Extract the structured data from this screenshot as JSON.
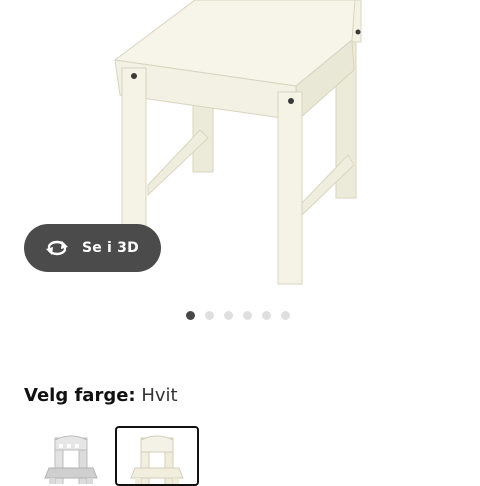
{
  "product": {
    "image_alt": "Barnestol, hvit"
  },
  "view_3d": {
    "label": "Se i 3D",
    "icon": "rotate-3d-icon"
  },
  "carousel": {
    "total": 6,
    "active_index": 0
  },
  "color_picker": {
    "label": "Velg farge:",
    "selected_value": "Hvit",
    "options": [
      {
        "name": "grey",
        "selected": false
      },
      {
        "name": "white",
        "selected": true
      }
    ]
  },
  "colors": {
    "button_bg": "#4b4b4b",
    "dot_active": "#484848",
    "dot_inactive": "#dfdfdf",
    "chair_white": "#f7f5ea",
    "chair_grey": "#d6d6d6"
  }
}
